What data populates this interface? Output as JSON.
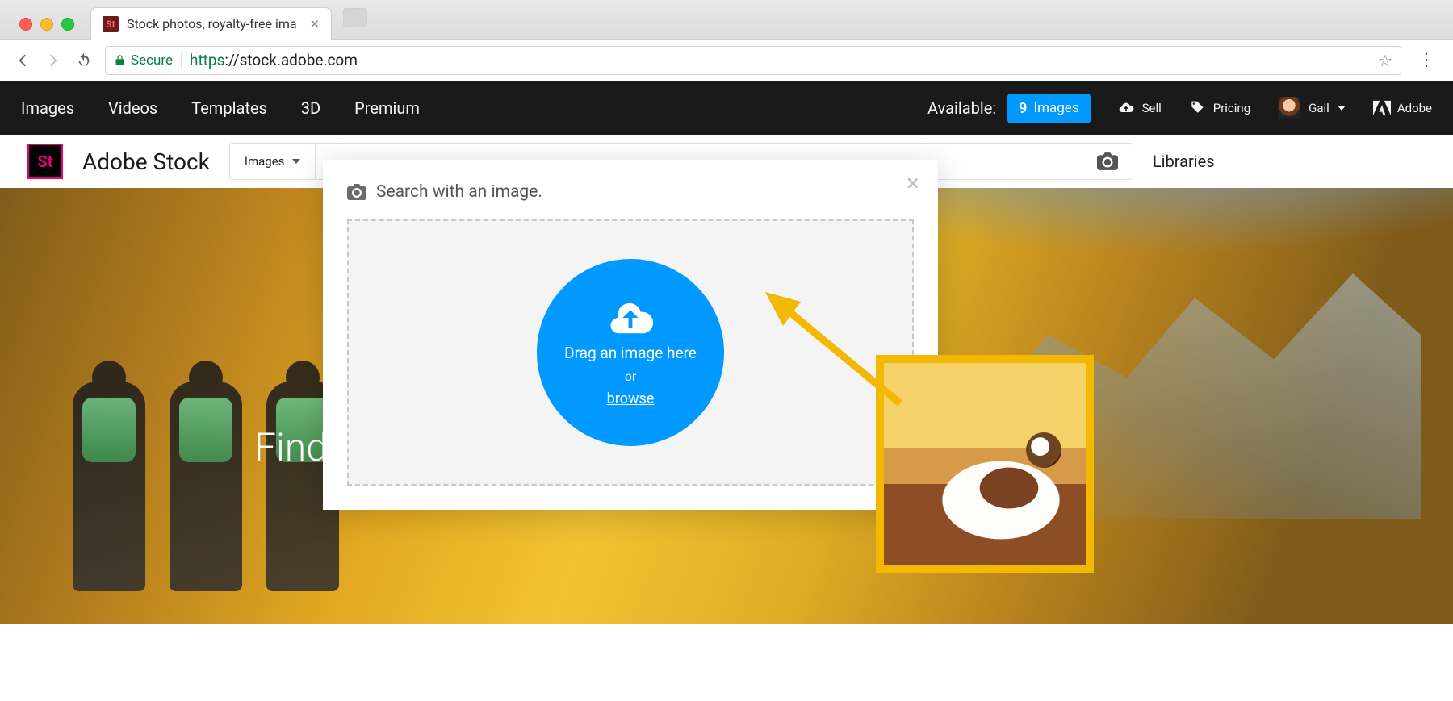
{
  "browser": {
    "tab_title": "Stock photos, royalty-free ima",
    "secure_label": "Secure",
    "url_protocol": "https",
    "url_rest": "://stock.adobe.com"
  },
  "topnav": {
    "left": [
      "Images",
      "Videos",
      "Templates",
      "3D",
      "Premium"
    ],
    "available_label": "Available:",
    "available_count": "9",
    "available_unit": "Images",
    "sell": "Sell",
    "pricing": "Pricing",
    "user_name": "Gail",
    "adobe_label": "Adobe"
  },
  "searchrow": {
    "brand": "Adobe Stock",
    "category": "Images",
    "placeholder": "",
    "libraries": "Libraries"
  },
  "hero": {
    "headline": "Find"
  },
  "popover": {
    "title": "Search with an image.",
    "drag_text": "Drag an image here",
    "or_text": "or",
    "browse_text": "browse"
  }
}
